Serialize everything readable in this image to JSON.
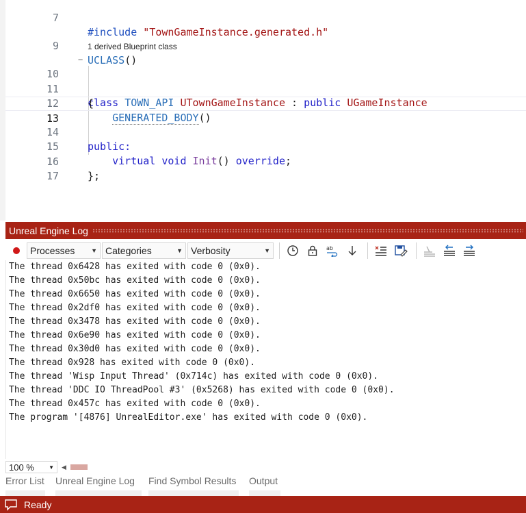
{
  "editor": {
    "codelens": "1 derived Blueprint class",
    "line_numbers": [
      "7",
      "9",
      "10",
      "11",
      "12",
      "13",
      "14",
      "15",
      "16",
      "17"
    ],
    "line7": {
      "directive": "#include",
      "path": "\"TownGameInstance.generated.h\""
    },
    "line9": {
      "macro": "UCLASS",
      "parens": "()"
    },
    "line10": {
      "kw_class": "class",
      "api": "TOWN_API",
      "name": "UTownGameInstance",
      "colon": ":",
      "kw_public": "public",
      "base": "UGameInstance"
    },
    "line11": {
      "brace": "{"
    },
    "line12": {
      "macro": "GENERATED_BODY",
      "parens": "()"
    },
    "line14": {
      "access": "public:"
    },
    "line15": {
      "kw_virtual": "virtual",
      "kw_void": "void",
      "fn": "Init",
      "parens": "()",
      "kw_override": "override",
      "semi": ";"
    },
    "line16": {
      "close": "};"
    }
  },
  "log_panel": {
    "title": "Unreal Engine Log",
    "filters": {
      "processes": "Processes",
      "categories": "Categories",
      "verbosity": "Verbosity"
    },
    "lines": [
      "The thread 0x6428 has exited with code 0 (0x0).",
      "The thread 0x50bc has exited with code 0 (0x0).",
      "The thread 0x6650 has exited with code 0 (0x0).",
      "The thread 0x2df0 has exited with code 0 (0x0).",
      "The thread 0x3478 has exited with code 0 (0x0).",
      "The thread 0x6e90 has exited with code 0 (0x0).",
      "The thread 0x30d0 has exited with code 0 (0x0).",
      "The thread 0x928 has exited with code 0 (0x0).",
      "The thread 'Wisp Input Thread' (0x714c) has exited with code 0 (0x0).",
      "The thread 'DDC IO ThreadPool #3' (0x5268) has exited with code 0 (0x0).",
      "The thread 0x457c has exited with code 0 (0x0).",
      "The program '[4876] UnrealEditor.exe' has exited with code 0 (0x0)."
    ],
    "zoom": "100 %"
  },
  "bottom_tabs": [
    "Error List",
    "Unreal Engine Log",
    "Find Symbol Results",
    "Output"
  ],
  "status": {
    "text": "Ready"
  },
  "colors": {
    "accent": "#a82315"
  },
  "icons": [
    "record-icon",
    "clock-icon",
    "lock-icon",
    "word-wrap-icon",
    "arrow-down-icon",
    "clear-all-icon",
    "save-icon",
    "erase-icon",
    "outdent-icon",
    "indent-icon",
    "chat-icon"
  ]
}
